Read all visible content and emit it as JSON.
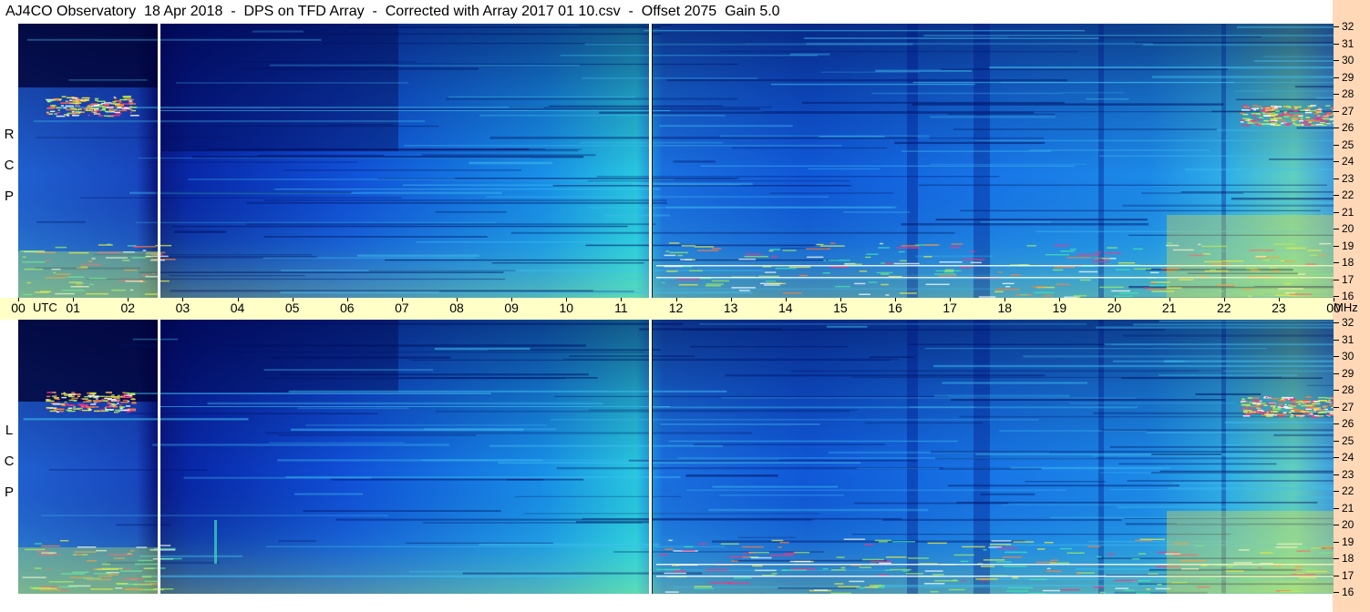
{
  "header": {
    "title": "AJ4CO Observatory  18 Apr 2018  -  DPS on TFD Array  -  Corrected with Array 2017 01 10.csv  -  Offset 2075  Gain 5.0"
  },
  "chart_data": [
    {
      "type": "heatmap",
      "panel_label": "R C P",
      "x_unit": "UTC hour",
      "xlim": [
        0,
        24
      ],
      "y_unit": "MHz",
      "ylim": [
        16,
        32
      ],
      "y_ticks": [
        "16",
        "17",
        "18",
        "19",
        "20",
        "21",
        "22",
        "23",
        "24",
        "25",
        "26",
        "27",
        "28",
        "29",
        "30",
        "31",
        "32"
      ],
      "colormap": [
        "#00005a",
        "#0010a0",
        "#0050e0",
        "#1090f0",
        "#20c8e0",
        "#40e8b0",
        "#a0f060",
        "#f0f040",
        "#ff8040",
        "#ff3080",
        "#ffffff"
      ]
    },
    {
      "type": "heatmap",
      "panel_label": "L C P",
      "x_unit": "UTC hour",
      "xlim": [
        0,
        24
      ],
      "y_unit": "MHz",
      "ylim": [
        16,
        32
      ],
      "y_ticks": [
        "16",
        "17",
        "18",
        "19",
        "20",
        "21",
        "22",
        "23",
        "24",
        "25",
        "26",
        "27",
        "28",
        "29",
        "30",
        "31",
        "32"
      ],
      "colormap": [
        "#00005a",
        "#0010a0",
        "#0050e0",
        "#1090f0",
        "#20c8e0",
        "#40e8b0",
        "#a0f060",
        "#f0f040",
        "#ff8040",
        "#ff3080",
        "#ffffff"
      ]
    }
  ],
  "time_axis": {
    "ticks": [
      "00",
      "01",
      "02",
      "03",
      "04",
      "05",
      "06",
      "07",
      "08",
      "09",
      "10",
      "11",
      "12",
      "13",
      "14",
      "15",
      "16",
      "17",
      "18",
      "19",
      "20",
      "21",
      "22",
      "23",
      "00"
    ],
    "utc_label": "UTC",
    "unit_label": "MHz"
  },
  "colors": {
    "right_strip": "#ffd8b8",
    "time_axis_bg": "#ffffc8"
  }
}
